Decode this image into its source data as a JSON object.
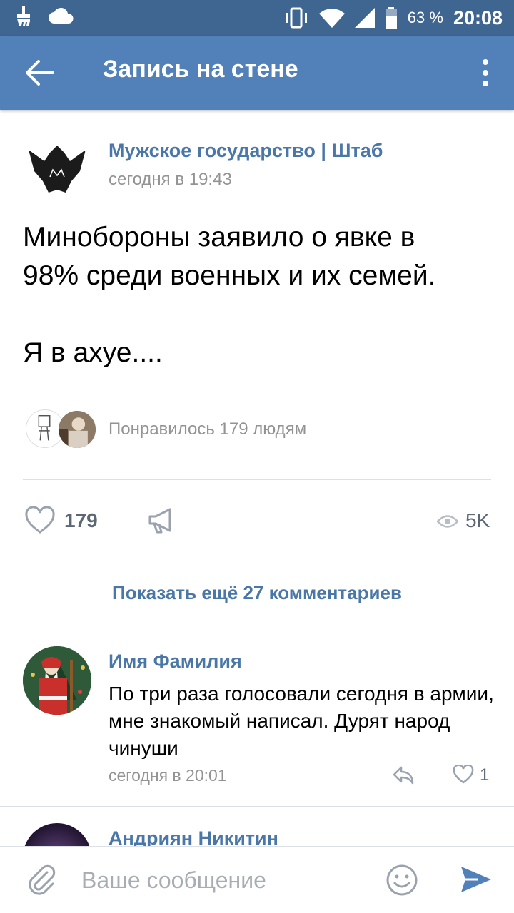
{
  "status_bar": {
    "battery_percent": "63 %",
    "time": "20:08",
    "icons": [
      "brush-icon",
      "cloud-icon",
      "vibrate-icon",
      "wifi-icon",
      "signal-icon",
      "battery-icon"
    ]
  },
  "app_bar": {
    "title": "Запись на стене",
    "back_icon": "arrow-left-icon",
    "menu_icon": "more-vertical-icon"
  },
  "post": {
    "author": "Мужское государство | Штаб",
    "time": "сегодня в 19:43",
    "text_line1": "Минобороны заявило о явке в",
    "text_line2": "98% среди военных и их семей.",
    "text_line3": "Я в ахуе....",
    "liked_by": "Понравилось 179 людям",
    "likes": "179",
    "views": "5K"
  },
  "comments_section": {
    "show_more": "Показать ещё 27 комментариев"
  },
  "comments": [
    {
      "author": "Имя Фамилия",
      "text": "По три раза голосовали сегодня в армии, мне знакомый написал. Дурят народ чинуши",
      "time": "сегодня в 20:01",
      "likes": "1"
    },
    {
      "author": "Андриян Никитин"
    }
  ],
  "composer": {
    "placeholder": "Ваше сообщение"
  },
  "colors": {
    "status_bar": "#3f6591",
    "app_bar": "#5181b8",
    "link": "#4a76a8",
    "secondary_text": "#939393"
  }
}
